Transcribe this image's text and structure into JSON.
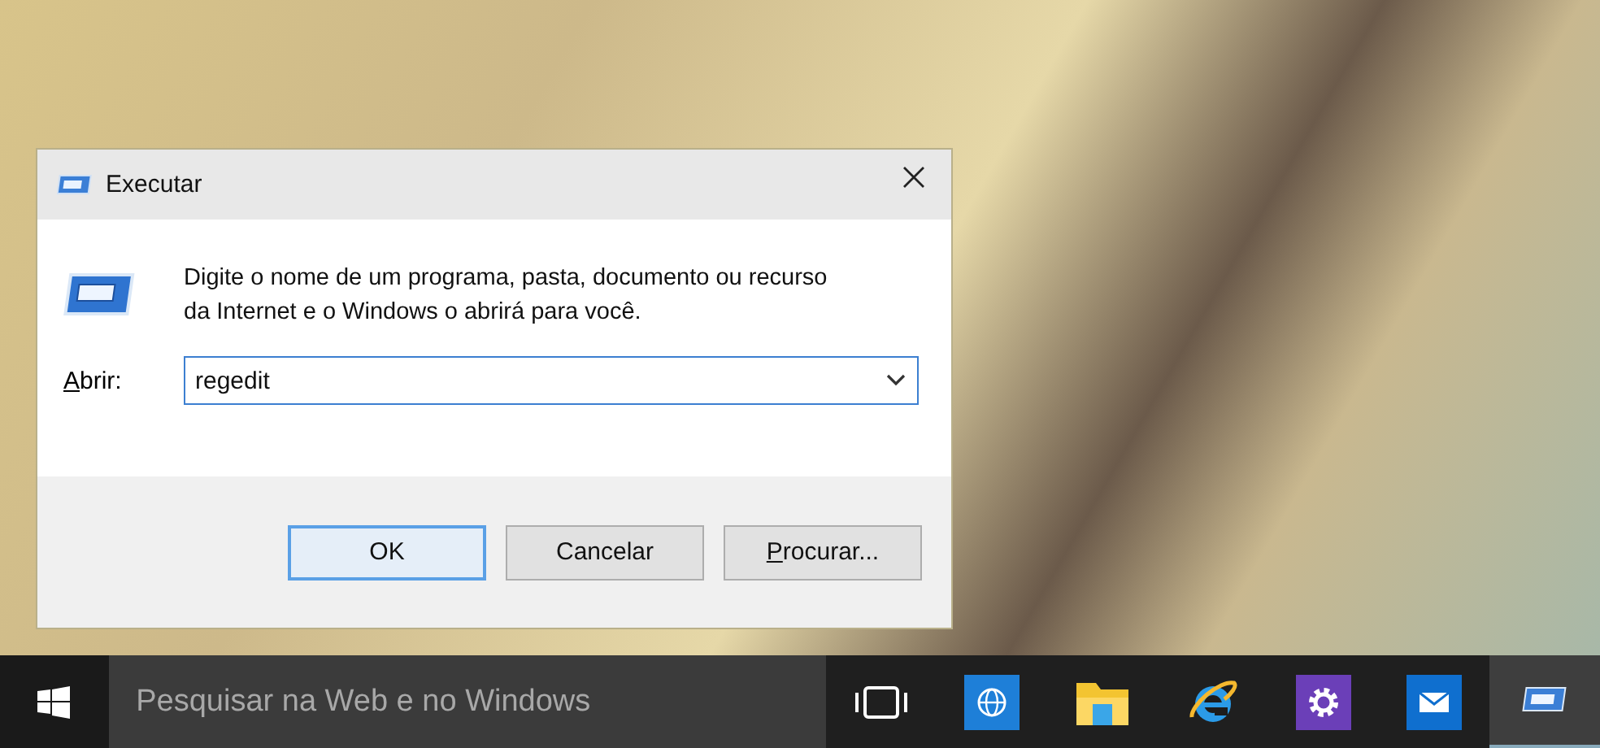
{
  "dialog": {
    "title": "Executar",
    "message": "Digite o nome de um programa, pasta, documento ou recurso da Internet e o Windows o abrirá para você.",
    "open_label": "Abrir:",
    "open_label_mnemonic": true,
    "open_value": "regedit",
    "buttons": [
      {
        "label": "OK",
        "default": true,
        "mnemonic": false
      },
      {
        "label": "Cancelar",
        "default": false,
        "mnemonic": false
      },
      {
        "label": "Procurar...",
        "default": false,
        "mnemonic": true
      }
    ]
  },
  "taskbar": {
    "search_placeholder": "Pesquisar na Web e no Windows",
    "apps": [
      {
        "kind": "taskview",
        "active": false
      },
      {
        "kind": "globe",
        "active": false
      },
      {
        "kind": "folder",
        "active": false
      },
      {
        "kind": "browser",
        "active": false
      },
      {
        "kind": "gear",
        "active": false
      },
      {
        "kind": "mail",
        "active": false
      },
      {
        "kind": "run",
        "active": true
      }
    ]
  }
}
